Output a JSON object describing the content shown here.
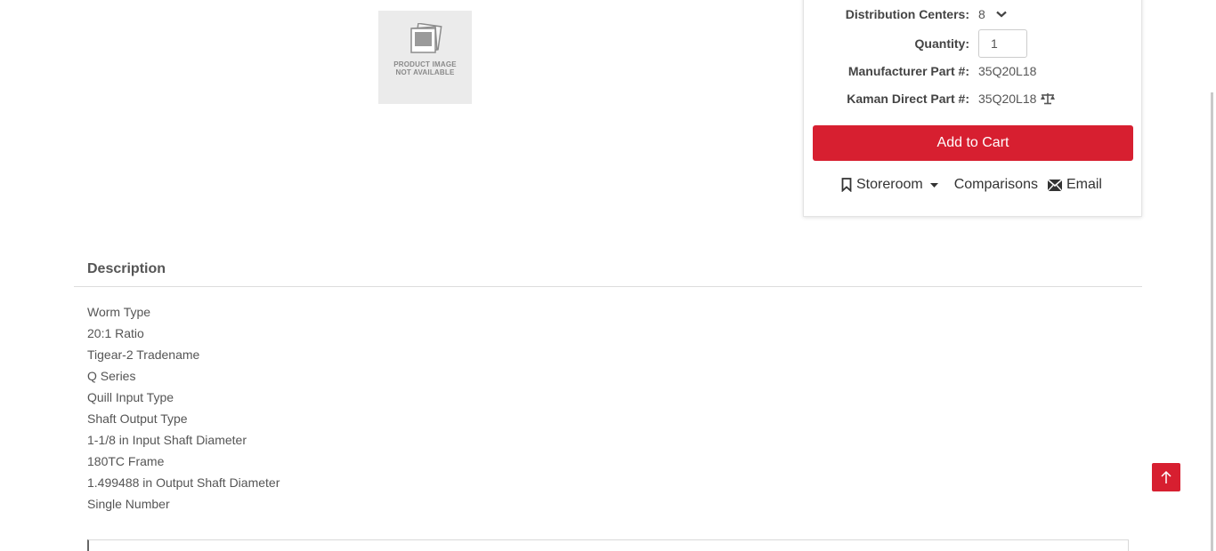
{
  "product_image": {
    "text_line1": "PRODUCT IMAGE",
    "text_line2": "NOT AVAILABLE"
  },
  "panel": {
    "distribution_label": "Distribution Centers:",
    "distribution_value": "8",
    "quantity_label": "Quantity:",
    "quantity_value": "1",
    "mfr_part_label": "Manufacturer Part #:",
    "mfr_part_value": "35Q20L18",
    "kaman_part_label": "Kaman Direct Part #:",
    "kaman_part_value": "35Q20L18",
    "add_to_cart": "Add to Cart",
    "storeroom": "Storeroom",
    "comparisons": "Comparisons",
    "email": "Email"
  },
  "description": {
    "heading": "Description",
    "items": [
      "Worm Type",
      "20:1 Ratio",
      "Tigear-2 Tradename",
      "Q Series",
      "Quill Input Type",
      "Shaft Output Type",
      "1-1/8 in Input Shaft Diameter",
      "180TC Frame",
      "1.499488 in Output Shaft Diameter",
      "Single Number"
    ]
  },
  "colors": {
    "accent": "#d71f30",
    "text": "#444444"
  },
  "icons": [
    "photo-stack-icon",
    "chevron-down-icon",
    "scale-icon",
    "bookmark-icon",
    "caret-down-icon",
    "envelope-icon",
    "arrow-up-icon"
  ]
}
